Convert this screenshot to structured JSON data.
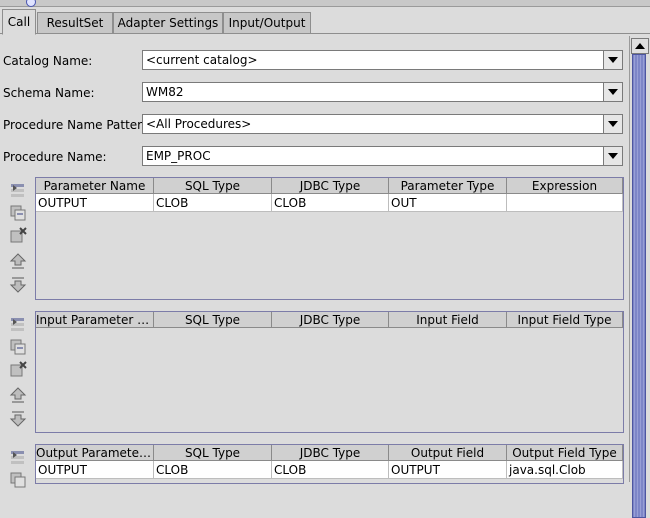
{
  "tabs": [
    {
      "label": "Call",
      "active": true
    },
    {
      "label": "ResultSet",
      "active": false
    },
    {
      "label": "Adapter Settings",
      "active": false
    },
    {
      "label": "Input/Output",
      "active": false
    }
  ],
  "fields": {
    "catalog": {
      "label": "Catalog Name:",
      "value": "<current catalog>"
    },
    "schema": {
      "label": "Schema Name:",
      "value": "WM82"
    },
    "pattern": {
      "label": "Procedure Name Pattern:",
      "value": "<All Procedures>"
    },
    "procedure": {
      "label": "Procedure Name:",
      "value": "EMP_PROC"
    }
  },
  "toolbar_icons": [
    "insert-row-icon",
    "duplicate-row-icon",
    "delete-row-icon",
    "move-up-icon",
    "move-down-icon"
  ],
  "tables": {
    "parameters": {
      "columns": [
        "Parameter Name",
        "SQL Type",
        "JDBC Type",
        "Parameter Type",
        "Expression"
      ],
      "rows": [
        [
          "OUTPUT",
          "CLOB",
          "CLOB",
          "OUT",
          ""
        ]
      ]
    },
    "input_params": {
      "columns": [
        "Input Parameter Na...",
        "SQL Type",
        "JDBC Type",
        "Input Field",
        "Input Field Type"
      ],
      "rows": []
    },
    "output_params": {
      "columns": [
        "Output Parameter N...",
        "SQL Type",
        "JDBC Type",
        "Output Field",
        "Output Field Type"
      ],
      "rows": [
        [
          "OUTPUT",
          "CLOB",
          "CLOB",
          "OUTPUT",
          "java.sql.Clob"
        ]
      ]
    }
  },
  "colors": {
    "accent": "#7d86c7",
    "window_bg": "#dcdcdc"
  }
}
